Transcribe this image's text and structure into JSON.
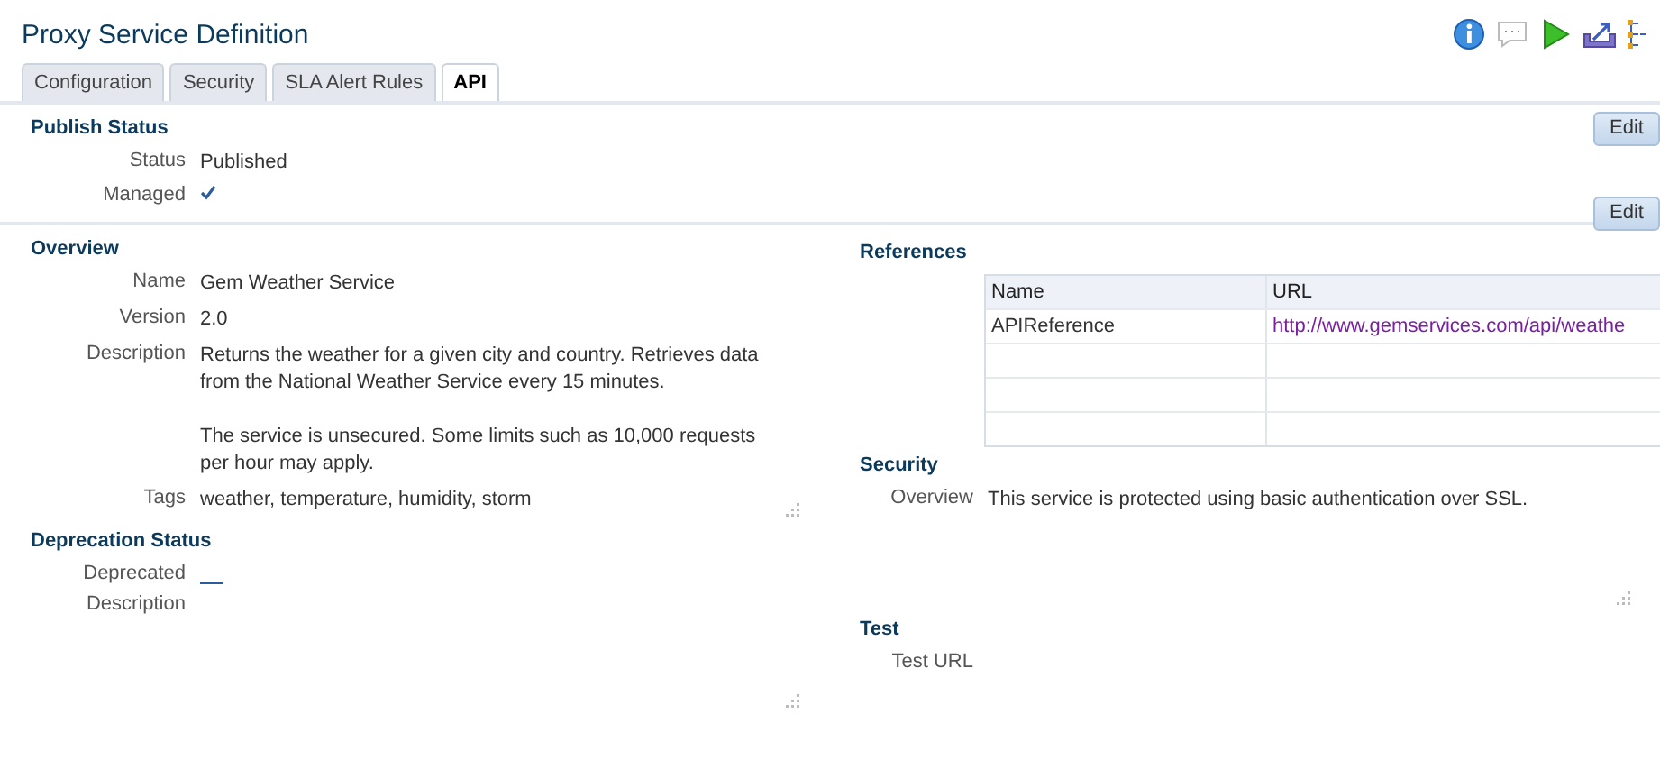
{
  "page": {
    "title": "Proxy Service Definition"
  },
  "toolbar": [
    {
      "kind": "info"
    },
    {
      "kind": "comment"
    },
    {
      "kind": "run"
    },
    {
      "kind": "publish"
    },
    {
      "kind": "tree"
    }
  ],
  "tabs": [
    {
      "label": "Configuration",
      "selected": false
    },
    {
      "label": "Security",
      "selected": false
    },
    {
      "label": "SLA Alert Rules",
      "selected": false
    },
    {
      "label": "API",
      "selected": true
    }
  ],
  "publish_status": {
    "heading": "Publish Status",
    "edit_button": "Edit",
    "status_label": "Status",
    "status": "Published",
    "managed_label": "Managed",
    "managed": true
  },
  "overview": {
    "heading": "Overview",
    "edit_button": "Edit",
    "fields": [
      {
        "label": "Name",
        "value": [
          "Gem Weather Service"
        ]
      },
      {
        "label": "Version",
        "value": [
          "2.0"
        ]
      },
      {
        "label": "Description",
        "value": [
          "Returns the weather for a given city and country. Retrieves data from the National Weather Service every 15 minutes.",
          "The service is unsecured. Some limits such as 10,000 requests per hour may apply."
        ]
      },
      {
        "label": "Tags",
        "value": [
          "weather, temperature, humidity, storm"
        ]
      }
    ]
  },
  "deprecation_status": {
    "heading": "Deprecation Status",
    "deprecated_label": "Deprecated",
    "deprecated": false,
    "description_label": "Description"
  },
  "references": {
    "heading": "References",
    "columns": [
      "Name",
      "URL"
    ],
    "rows": [
      {
        "name": "APIReference",
        "url": "http://www.gemservices.com/api/weathe"
      }
    ]
  },
  "security": {
    "heading": "Security",
    "label": "Overview",
    "value": "This service is protected using basic authentication over SSL."
  },
  "test": {
    "heading": "Test",
    "label": "Test URL"
  }
}
